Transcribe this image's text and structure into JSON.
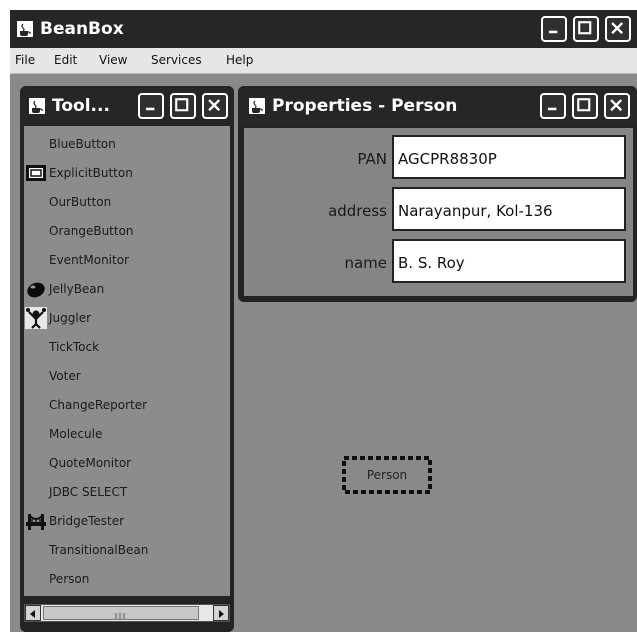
{
  "main_window": {
    "title": "BeanBox",
    "menus": [
      "File",
      "Edit",
      "View",
      "Services",
      "Help"
    ]
  },
  "toolbox": {
    "title": "Tool...",
    "items": [
      {
        "label": "BlueButton",
        "icon": "none"
      },
      {
        "label": "ExplicitButton",
        "icon": "button-bean-icon"
      },
      {
        "label": "OurButton",
        "icon": "none"
      },
      {
        "label": "OrangeButton",
        "icon": "none"
      },
      {
        "label": "EventMonitor",
        "icon": "none"
      },
      {
        "label": "JellyBean",
        "icon": "jellybean-icon"
      },
      {
        "label": "Juggler",
        "icon": "juggler-icon"
      },
      {
        "label": "TickTock",
        "icon": "none"
      },
      {
        "label": "Voter",
        "icon": "none"
      },
      {
        "label": "ChangeReporter",
        "icon": "none"
      },
      {
        "label": "Molecule",
        "icon": "none"
      },
      {
        "label": "QuoteMonitor",
        "icon": "none"
      },
      {
        "label": "JDBC SELECT",
        "icon": "none"
      },
      {
        "label": "BridgeTester",
        "icon": "bridge-icon"
      },
      {
        "label": "TransitionalBean",
        "icon": "none"
      },
      {
        "label": "Person",
        "icon": "none"
      }
    ]
  },
  "properties": {
    "title": "Properties - Person",
    "fields": [
      {
        "label": "PAN",
        "value": "AGCPR8830P"
      },
      {
        "label": "address",
        "value": "Narayanpur, Kol-136"
      },
      {
        "label": "name",
        "value": "B. S. Roy"
      }
    ]
  },
  "canvas": {
    "bean_label": "Person"
  },
  "colors": {
    "titlebar": "#262626",
    "desktop": "#8a8a8a",
    "menubar": "#e6e6e6",
    "field_bg": "#ffffff"
  }
}
